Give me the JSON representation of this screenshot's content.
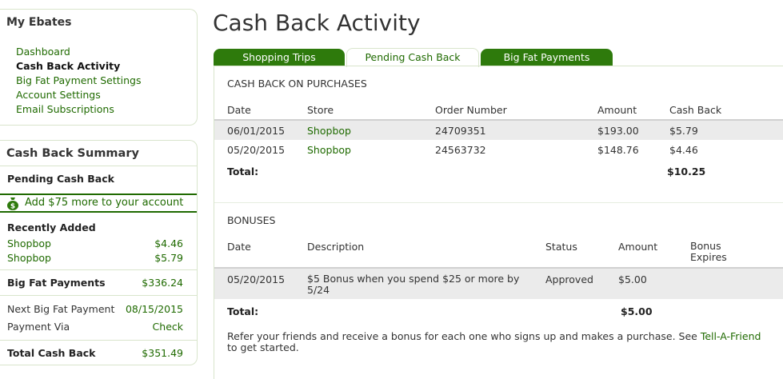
{
  "sidebar": {
    "my_ebates": {
      "title": "My Ebates",
      "items": [
        "Dashboard",
        "Cash Back Activity",
        "Big Fat Payment Settings",
        "Account Settings",
        "Email Subscriptions"
      ]
    },
    "summary": {
      "title": "Cash Back Summary",
      "pending_label": "Pending Cash Back",
      "promo_text": "Add $75 more to your account",
      "recently_added_label": "Recently Added",
      "recent": [
        {
          "store": "Shopbop",
          "amount": "$4.46"
        },
        {
          "store": "Shopbop",
          "amount": "$5.79"
        }
      ],
      "big_fat_payments_label": "Big Fat Payments",
      "big_fat_payments_value": "$336.24",
      "next_payment_label": "Next Big Fat Payment",
      "next_payment_value": "08/15/2015",
      "payment_via_label": "Payment Via",
      "payment_via_value": "Check",
      "total_label": "Total Cash Back",
      "total_value": "$351.49"
    }
  },
  "main": {
    "title": "Cash Back Activity",
    "tabs": [
      {
        "label": "Shopping Trips",
        "active": false
      },
      {
        "label": "Pending Cash Back",
        "active": true
      },
      {
        "label": "Big Fat Payments",
        "active": false
      }
    ],
    "purchases": {
      "title": "CASH BACK ON PURCHASES",
      "headers": [
        "Date",
        "Store",
        "Order Number",
        "Amount",
        "Cash Back"
      ],
      "rows": [
        {
          "date": "06/01/2015",
          "store": "Shopbop",
          "order": "24709351",
          "amount": "$193.00",
          "cashback": "$5.79"
        },
        {
          "date": "05/20/2015",
          "store": "Shopbop",
          "order": "24563732",
          "amount": "$148.76",
          "cashback": "$4.46"
        }
      ],
      "total_label": "Total:",
      "total_value": "$10.25"
    },
    "bonuses": {
      "title": "BONUSES",
      "headers": [
        "Date",
        "Description",
        "Status",
        "Amount",
        "Bonus Expires"
      ],
      "rows": [
        {
          "date": "05/20/2015",
          "description": "$5 Bonus when you spend $25 or more by 5/24",
          "status": "Approved",
          "amount": "$5.00",
          "expires": ""
        }
      ],
      "total_label": "Total:",
      "total_value": "$5.00"
    },
    "referral": {
      "text": "Refer your friends and receive a bonus for each one who signs up and makes a purchase. See",
      "link": "Tell-A-Friend",
      "text_after": "to get started."
    }
  },
  "colors": {
    "accent": "#1f6a00",
    "tab_green": "#2e7a0c",
    "row_shade": "#ebebeb",
    "border": "#d9e5cc"
  },
  "icons": {
    "promo": "money-bag-icon"
  }
}
